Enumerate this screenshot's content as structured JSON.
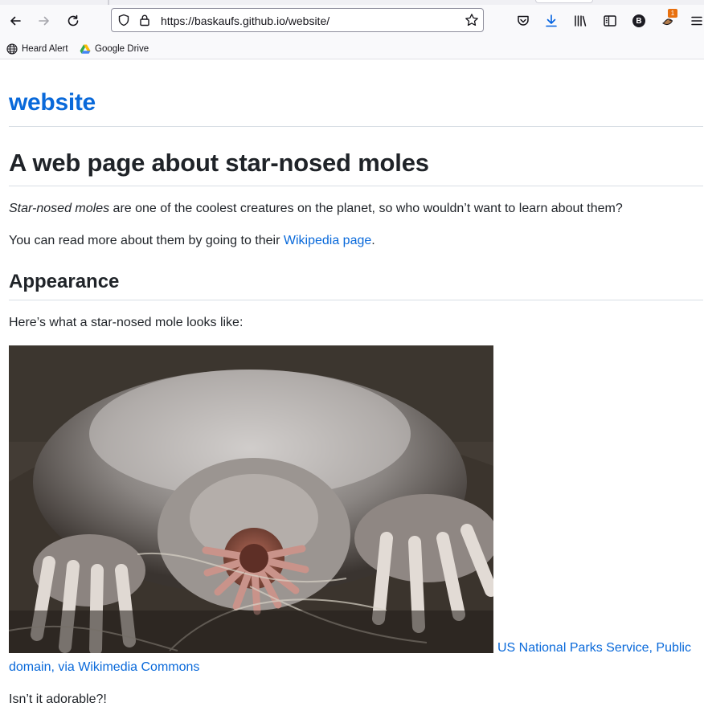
{
  "browser": {
    "url": "https://baskaufs.github.io/website/",
    "extension_badge": "1",
    "profile_initial": "B",
    "bookmarks": [
      {
        "label": "Heard Alert",
        "icon": "globe-icon"
      },
      {
        "label": "Google Drive",
        "icon": "google-drive-icon"
      }
    ]
  },
  "site": {
    "title": "website"
  },
  "page": {
    "heading": "A web page about star-nosed moles",
    "intro_em": "Star-nosed moles",
    "intro_rest": " are one of the coolest creatures on the planet, so who wouldn’t want to learn about them?",
    "read_more_prefix": "You can read more about them by going to their ",
    "wikipedia_link": "Wikipedia page",
    "read_more_suffix": ".",
    "appearance_heading": "Appearance",
    "appearance_text": "Here’s what a star-nosed mole looks like:",
    "image_subject": "star-nosed mole photo",
    "credit_line1": "US National Parks Service, Public",
    "credit_line2": "domain, via Wikimedia Commons",
    "closing_text": "Isn’t it adorable?!"
  },
  "colors": {
    "link": "#0969da",
    "text": "#1f2328",
    "rule": "#d8dee4"
  }
}
